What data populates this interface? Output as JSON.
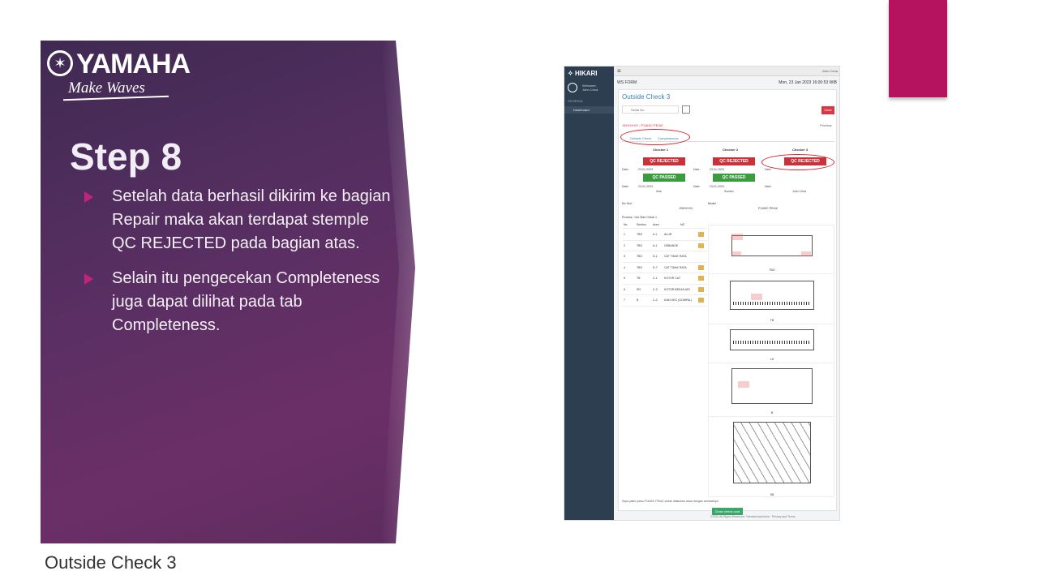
{
  "brand": {
    "name": "YAMAHA",
    "tagline": "Make Waves",
    "logo_icon": "tuning-fork-emblem"
  },
  "slide": {
    "title": "Step 8",
    "bullets": [
      "Setelah data berhasil dikirim ke bagian Repair maka akan terdapat stemple QC REJECTED pada bagian atas.",
      "Selain itu pengecekan Completeness juga dapat dilihat pada tab Completeness."
    ],
    "caption": "Outside Check 3"
  },
  "colors": {
    "panel": "#5a2f63",
    "accent": "#b5135f",
    "bullet": "#c2247a",
    "highlight_ring": "#d9222f"
  },
  "screenshot": {
    "app_name": "HIKARI",
    "menu_icon": "hamburger-icon",
    "user": "John Cena",
    "welcome": "Welcome,",
    "welcome_user": "John Cena",
    "section_label": "GENERAL",
    "nav_dashboard": "Dashboard",
    "form_label": "WS FORM",
    "datetime": "Mon, 23 Jan 2023 16:00:53 WIB",
    "page_title": "Outside Check 3",
    "serial_placeholder": "Serial No",
    "clear_label": "Clear",
    "serial_value": "J39XXXXX - P116SC PE/AZ",
    "priority_label": "Prioritas",
    "tabs": [
      "Outside Check",
      "Completeness"
    ],
    "checkers": [
      {
        "title": "Checker 1",
        "top_stamp": "QC REJECTED",
        "bottom_stamp": "QC PASSED",
        "date1": "23-01-2023",
        "date2": "23-01-2023",
        "name": "Ilma"
      },
      {
        "title": "Checker 2",
        "top_stamp": "QC REJECTED",
        "bottom_stamp": "QC PASSED",
        "date1": "23-01-2023",
        "date2": "23-01-2023",
        "name": "Sumiko"
      },
      {
        "title": "Checker 3",
        "top_stamp": "QC REJECTED",
        "bottom_stamp": "",
        "date1": "",
        "date2": "",
        "name": "John Cena"
      }
    ],
    "date_label": "Date :",
    "noser_label": "No Seri :",
    "noser_value": "J39XXXXX",
    "model_label": "Model :",
    "model_value": "P116SC PE/AZ",
    "process_label": "Process : Out Side Check 1",
    "table_headers": [
      "No",
      "Section",
      "Area",
      "NG"
    ],
    "rows": [
      {
        "no": "1",
        "section": "TBO",
        "area": "A-1",
        "ng": "ALUR"
      },
      {
        "no": "2",
        "section": "TBO",
        "area": "A-1",
        "ng": "GEBANGE"
      },
      {
        "no": "3",
        "section": "TBO",
        "area": "D-1",
        "ng": "CAT TIDAK RATA"
      },
      {
        "no": "4",
        "section": "TBO",
        "area": "D-7",
        "ng": "CAT TIDAK RATA"
      },
      {
        "no": "5",
        "section": "TB",
        "area": "C-1",
        "ng": "KOTOR CAT"
      },
      {
        "no": "6",
        "section": "SR",
        "area": "C-2",
        "ng": "KOTOR BEKAS ARI"
      },
      {
        "no": "7",
        "section": "B",
        "area": "C-2",
        "ng": "KAKI KEC (GOMPAL)"
      }
    ],
    "diagram_labels": [
      "TBO",
      "TB",
      "LH",
      "B",
      "SB"
    ],
    "agreement": "Saya yakin piano P116SC PE/AZ sudah dilakukan cesar dengan semestinya",
    "close_label": "Close check card",
    "footer": "©2022 All Rights Reserved. Yamaha Indonesia · Privacy and Terms"
  }
}
